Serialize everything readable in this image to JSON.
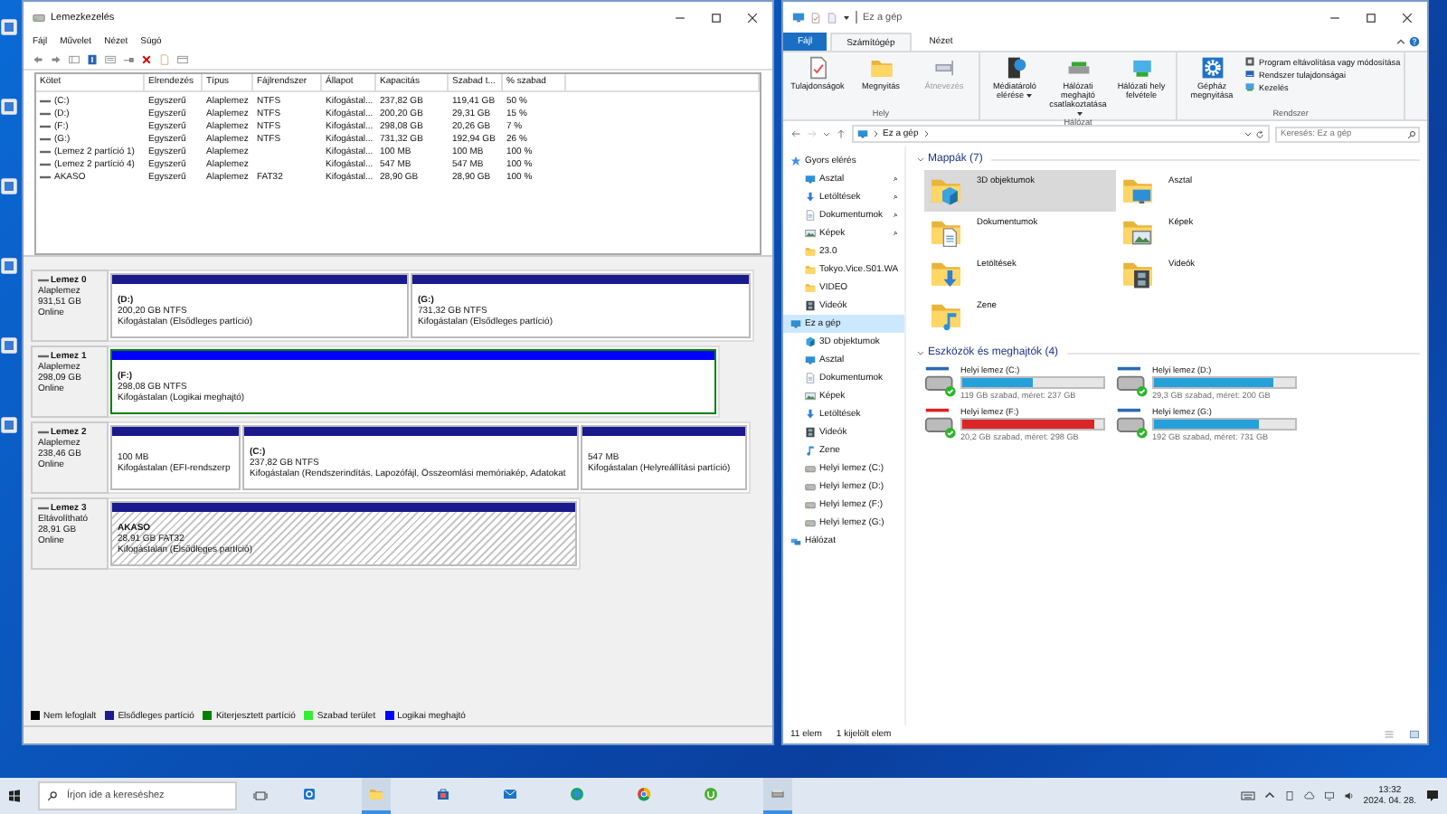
{
  "disk_management": {
    "title": "Lemezkezelés",
    "menu": [
      "Fájl",
      "Művelet",
      "Nézet",
      "Súgó"
    ],
    "table": {
      "columns": [
        "Kötet",
        "Elrendezés",
        "Típus",
        "Fájlrendszer",
        "Állapot",
        "Kapacitás",
        "Szabad t...",
        "% szabad"
      ],
      "rows": [
        {
          "volume": "(C:)",
          "layout": "Egyszerű",
          "type": "Alaplemez",
          "filesystem": "NTFS",
          "status": "Kifogástal...",
          "capacity": "237,82 GB",
          "free": "119,41 GB",
          "free_pct": "50 %"
        },
        {
          "volume": "(D:)",
          "layout": "Egyszerű",
          "type": "Alaplemez",
          "filesystem": "NTFS",
          "status": "Kifogástal...",
          "capacity": "200,20 GB",
          "free": "29,31 GB",
          "free_pct": "15 %"
        },
        {
          "volume": "(F:)",
          "layout": "Egyszerű",
          "type": "Alaplemez",
          "filesystem": "NTFS",
          "status": "Kifogástal...",
          "capacity": "298,08 GB",
          "free": "20,26 GB",
          "free_pct": "7 %"
        },
        {
          "volume": "(G:)",
          "layout": "Egyszerű",
          "type": "Alaplemez",
          "filesystem": "NTFS",
          "status": "Kifogástal...",
          "capacity": "731,32 GB",
          "free": "192,94 GB",
          "free_pct": "26 %"
        },
        {
          "volume": "(Lemez 2 partíció 1)",
          "layout": "Egyszerű",
          "type": "Alaplemez",
          "status": "Kifogástal...",
          "capacity": "100 MB",
          "free": "100 MB",
          "free_pct": "100 %"
        },
        {
          "volume": "(Lemez 2 partíció 4)",
          "layout": "Egyszerű",
          "type": "Alaplemez",
          "status": "Kifogástal...",
          "capacity": "547 MB",
          "free": "547 MB",
          "free_pct": "100 %"
        },
        {
          "volume": "AKASO",
          "layout": "Egyszerű",
          "type": "Alaplemez",
          "filesystem": "FAT32",
          "status": "Kifogástal...",
          "capacity": "28,90 GB",
          "free": "28,90 GB",
          "free_pct": "100 %"
        }
      ]
    },
    "disks": [
      {
        "name": "Lemez 0",
        "type": "Alaplemez",
        "size": "931,51 GB",
        "status": "Online",
        "partitions": [
          {
            "kind": "primary",
            "selected": false,
            "label": "(D:)",
            "size": "200,20 GB NTFS",
            "status": "Kifogástalan (Elsődleges partíció)"
          },
          {
            "kind": "primary",
            "selected": false,
            "label": "(G:)",
            "size": "731,32 GB NTFS",
            "status": "Kifogástalan (Elsődleges partíció)"
          }
        ]
      },
      {
        "name": "Lemez 1",
        "type": "Alaplemez",
        "size": "298,09 GB",
        "status": "Online",
        "partitions": [
          {
            "kind": "logical",
            "selected": false,
            "label": "(F:)",
            "size": "298,08 GB NTFS",
            "status": "Kifogástalan (Logikai meghajtó)"
          }
        ]
      },
      {
        "name": "Lemez 2",
        "type": "Alaplemez",
        "size": "238,46 GB",
        "status": "Online",
        "partitions": [
          {
            "kind": "primary",
            "selected": false,
            "size": "100 MB",
            "status": "Kifogástalan (EFI-rendszerp"
          },
          {
            "kind": "primary",
            "selected": false,
            "label": "(C:)",
            "size": "237,82 GB NTFS",
            "status": "Kifogástalan (Rendszerindítás, Lapozófájl, Összeomlási memóriakép, Adatokat"
          },
          {
            "kind": "primary",
            "selected": false,
            "size": "547 MB",
            "status": "Kifogástalan (Helyreállítási partíció)"
          }
        ]
      },
      {
        "name": "Lemez 3",
        "type": "Eltávolítható",
        "size": "28,91 GB",
        "status": "Online",
        "partitions": [
          {
            "kind": "primary",
            "selected": true,
            "label": "AKASO",
            "size": "28,91 GB FAT32",
            "status": "Kifogástalan (Elsődleges partíció)"
          }
        ]
      }
    ],
    "legend": [
      {
        "label": "Nem lefoglalt",
        "color": "#000000"
      },
      {
        "label": "Elsődleges partíció",
        "color": "#1a1a8c"
      },
      {
        "label": "Kiterjesztett partíció",
        "color": "#008000"
      },
      {
        "label": "Szabad terület",
        "color": "#33ee33"
      },
      {
        "label": "Logikai meghajtó",
        "color": "#0000ff"
      }
    ]
  },
  "explorer": {
    "title": "Ez a gép",
    "tabs": [
      {
        "label": "Fájl",
        "kind": "file",
        "selected": false
      },
      {
        "label": "Számítógép",
        "kind": "tab",
        "selected": true
      },
      {
        "label": "Nézet",
        "kind": "tab",
        "selected": false
      }
    ],
    "ribbon": [
      {
        "label": "Hely",
        "buttons": [
          {
            "label": "Tulajdonságok",
            "disabled": false,
            "dropdown": false
          },
          {
            "label": "Megnyitás",
            "disabled": false,
            "dropdown": false
          },
          {
            "label": "Átnevezés",
            "disabled": true,
            "dropdown": false
          }
        ]
      },
      {
        "label": "Hálózat",
        "buttons": [
          {
            "label": "Médiatároló elérése",
            "disabled": false,
            "dropdown": true
          },
          {
            "label": "Hálózati meghajtó csatlakoztatása",
            "disabled": false,
            "dropdown": true
          },
          {
            "label": "Hálózati hely felvétele",
            "disabled": false,
            "dropdown": false
          }
        ]
      },
      {
        "label": "Rendszer",
        "buttons": [
          {
            "label": "Gépház megnyitása",
            "disabled": false,
            "dropdown": false
          }
        ],
        "small_buttons": [
          "Program eltávolítása vagy módosítása",
          "Rendszer tulajdonságai",
          "Kezelés"
        ]
      }
    ],
    "address": "Ez a gép",
    "search_placeholder": "Keresés: Ez a gép",
    "nav": [
      {
        "label": "Gyors elérés",
        "selected": false,
        "children": [
          {
            "label": "Asztal",
            "selected": false,
            "pinned": true
          },
          {
            "label": "Letöltések",
            "selected": false,
            "pinned": true
          },
          {
            "label": "Dokumentumok",
            "selected": false,
            "pinned": true
          },
          {
            "label": "Képek",
            "selected": false,
            "pinned": true
          },
          {
            "label": "23.0",
            "selected": false,
            "pinned": false
          },
          {
            "label": "Tokyo.Vice.S01.WA",
            "selected": false,
            "pinned": false
          },
          {
            "label": "VIDEO",
            "selected": false,
            "pinned": false
          },
          {
            "label": "Videók",
            "selected": false,
            "pinned": false
          }
        ]
      },
      {
        "label": "Ez a gép",
        "selected": true,
        "children": [
          {
            "label": "3D objektumok",
            "selected": false
          },
          {
            "label": "Asztal",
            "selected": false
          },
          {
            "label": "Dokumentumok",
            "selected": false
          },
          {
            "label": "Képek",
            "selected": false
          },
          {
            "label": "Letöltések",
            "selected": false
          },
          {
            "label": "Videók",
            "selected": false
          },
          {
            "label": "Zene",
            "selected": false
          },
          {
            "label": "Helyi lemez (C:)",
            "selected": false
          },
          {
            "label": "Helyi lemez (D:)",
            "selected": false
          },
          {
            "label": "Helyi lemez (F:)",
            "selected": false
          },
          {
            "label": "Helyi lemez (G:)",
            "selected": false
          }
        ]
      },
      {
        "label": "Hálózat",
        "selected": false
      }
    ],
    "folders_heading": "Mappák (7)",
    "folders": [
      {
        "label": "3D objektumok",
        "selected": true
      },
      {
        "label": "Asztal",
        "selected": false
      },
      {
        "label": "Dokumentumok",
        "selected": false
      },
      {
        "label": "Képek",
        "selected": false
      },
      {
        "label": "Letöltések",
        "selected": false
      },
      {
        "label": "Videók",
        "selected": false
      },
      {
        "label": "Zene",
        "selected": false
      }
    ],
    "drives_heading": "Eszközök és meghajtók (4)",
    "drives": [
      {
        "label": "Helyi lemez (C:)",
        "level": 0.5,
        "low_space": false,
        "info": "119 GB szabad, méret: 237 GB"
      },
      {
        "label": "Helyi lemez (D:)",
        "level": 0.85,
        "low_space": false,
        "info": "29,3 GB szabad, méret: 200 GB"
      },
      {
        "label": "Helyi lemez (F:)",
        "level": 0.93,
        "low_space": true,
        "info": "20,2 GB szabad, méret: 298 GB"
      },
      {
        "label": "Helyi lemez (G:)",
        "level": 0.74,
        "low_space": false,
        "info": "192 GB szabad, méret: 731 GB"
      }
    ],
    "status": [
      "11 elem",
      "1 kijelölt elem"
    ]
  },
  "taskbar": {
    "search_placeholder": "Írjon ide a kereséshez",
    "apps": [
      {
        "open": false
      },
      {
        "open": true
      },
      {
        "open": false
      },
      {
        "open": false
      },
      {
        "open": false
      },
      {
        "open": false
      },
      {
        "open": false
      },
      {
        "open": true
      }
    ],
    "time": "13:32",
    "date": "2024. 04. 28."
  }
}
